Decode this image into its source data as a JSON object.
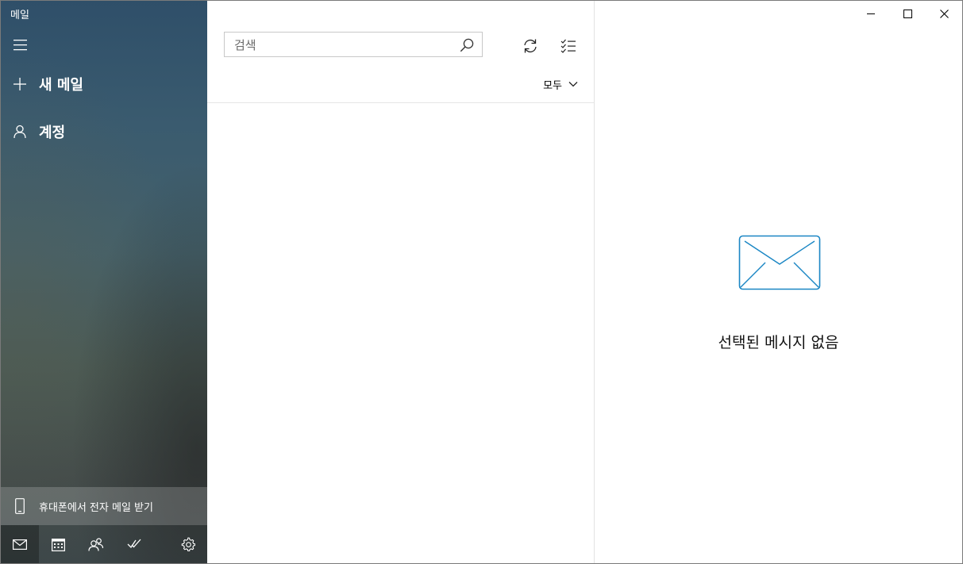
{
  "app": {
    "title": "메일"
  },
  "sidebar": {
    "new_mail_label": "새 메일",
    "accounts_label": "계정",
    "phone_promo_label": "휴대폰에서 전자 메일 받기",
    "bottom_nav": [
      {
        "name": "mail",
        "icon": "mail-icon",
        "active": true
      },
      {
        "name": "calendar",
        "icon": "calendar-icon",
        "active": false
      },
      {
        "name": "people",
        "icon": "people-icon",
        "active": false
      },
      {
        "name": "todo",
        "icon": "todo-icon",
        "active": false
      },
      {
        "name": "settings",
        "icon": "gear-icon",
        "active": false
      }
    ]
  },
  "list": {
    "search_placeholder": "검색",
    "search_value": "",
    "filter_label": "모두"
  },
  "reading": {
    "empty_message": "선택된 메시지 없음"
  },
  "colors": {
    "accent": "#1a86c4",
    "sidebar_top": "#2f4f69",
    "sidebar_bottom": "#3d4749"
  }
}
